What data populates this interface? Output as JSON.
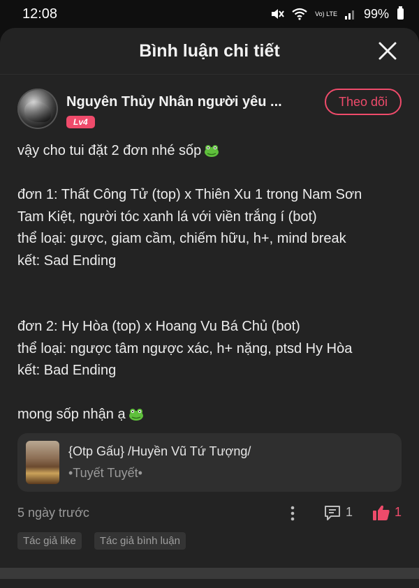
{
  "status_bar": {
    "time": "12:08",
    "battery": "99%",
    "network": "Vo) LTE"
  },
  "header": {
    "title": "Bình luận chi tiết"
  },
  "comment": {
    "username": "Nguyên Thủy Nhân người yêu ...",
    "level": "Lv4",
    "follow_label": "Theo dõi",
    "lines": [
      "vậy cho tui đặt 2 đơn nhé sốp",
      "",
      "đơn 1: Thất Công Tử (top) x Thiên Xu 1 trong Nam Sơn",
      "Tam Kiệt, người tóc xanh lá với viền trắng í (bot)",
      "thể loại: gược, giam cầm, chiếm hữu, h+, mind break",
      "kết: Sad Ending",
      "",
      "",
      "đơn 2: Hy Hòa (top) x Hoang Vu Bá Chủ (bot)",
      "thể loại: ngược tâm ngược xác, h+ nặng, ptsd Hy Hòa",
      "kết: Bad Ending",
      "",
      "mong sốp nhận ạ"
    ],
    "book": {
      "title": "{Otp Gấu} /Huyền Vũ Tứ Tượng/",
      "author": "•Tuyết Tuyết•"
    },
    "time_ago": "5 ngày trước",
    "reply_count": "1",
    "like_count": "1",
    "tags": [
      "Tác giả like",
      "Tác giả bình luận"
    ]
  },
  "icons": {
    "close": "close-icon",
    "more": "more-vertical-icon",
    "reply": "comment-icon",
    "like": "thumbs-up-icon",
    "emoji": "frog-emoji-icon"
  },
  "colors": {
    "accent": "#ef4b6b",
    "sheet_bg": "#232323",
    "card_bg": "#2f2f2f"
  }
}
